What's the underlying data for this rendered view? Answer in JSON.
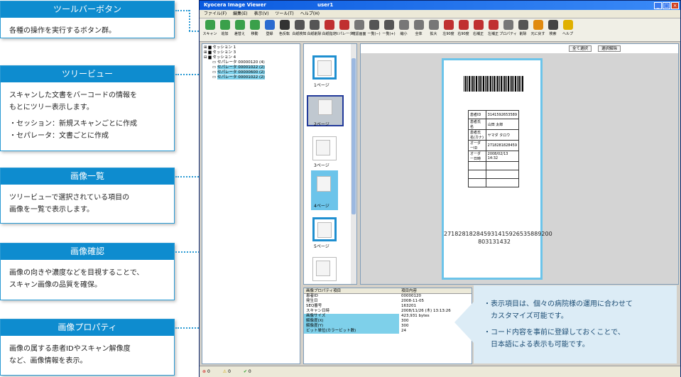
{
  "callouts": [
    {
      "title": "ツールバーボタン",
      "lines": [
        "各種の操作を実行するボタン群。"
      ]
    },
    {
      "title": "ツリービュー",
      "lines": [
        "スキャンした文書をバーコードの情報を",
        "もとにツリー表示します。",
        "・セッション：新規スキャンごとに作成",
        "・セパレータ：文書ごとに作成"
      ]
    },
    {
      "title": "画像一覧",
      "lines": [
        "ツリービューで選択されている項目の",
        "画像を一覧で表示します。"
      ]
    },
    {
      "title": "画像確認",
      "lines": [
        "画像の向きや濃度などを目視することで、",
        "スキャン画像の品質を確保。"
      ]
    },
    {
      "title": "画像プロパティ",
      "lines": [
        "画像の属する患者IDやスキャン解像度",
        "など、画像情報を表示。"
      ]
    }
  ],
  "app": {
    "title": "Kyocera Image Viewer",
    "user": "user1",
    "menu": [
      "ファイル(F)",
      "編集(E)",
      "表示(V)",
      "ツール(T)",
      "ヘルプ(H)"
    ],
    "toolbar": [
      "スキャン",
      "追加",
      "差替え",
      "移動",
      "登録",
      "色反転",
      "白紙検知",
      "白紙削除",
      "白紙指定",
      "セパレータ",
      "確認画面",
      "一覧(−)",
      "一覧(+)",
      "縮小",
      "全体",
      "拡大",
      "左90度",
      "右90度",
      "右補正",
      "左補正",
      "プロパティ",
      "削除",
      "元に戻す",
      "検索",
      "ヘルプ"
    ],
    "toolbar_colors": [
      "#3aa04a",
      "#3aa04a",
      "#3aa04a",
      "#3aa04a",
      "#2b6bd0",
      "#333",
      "#555",
      "#555",
      "#c03030",
      "#c03030",
      "#777",
      "#555",
      "#555",
      "#777",
      "#777",
      "#777",
      "#c03030",
      "#c03030",
      "#c03030",
      "#c03030",
      "#777",
      "#555",
      "#e08a10",
      "#444",
      "#e0b000"
    ],
    "tree": [
      "セッション 1",
      "セッション 3",
      "セッション 4",
      "セパレータ 00000120 (4)",
      "セパレータ 00001022 (2)",
      "セパレータ 00000600 (2)",
      "セパレータ 00001022 (2)"
    ],
    "thumbs": [
      "1ページ",
      "2ページ",
      "3ページ",
      "4ページ",
      "5ページ"
    ],
    "viewer_buttons": [
      "全て選択",
      "選択解除"
    ],
    "document": {
      "rows": [
        [
          "患者ID",
          "3141592653589"
        ],
        [
          "患者氏名",
          "山田 太郎"
        ],
        [
          "患者氏名(カナ)",
          "ヤマダ タロウ"
        ],
        [
          "オーダーID",
          "2718281828459"
        ],
        [
          "オーダー日時",
          "2008/02/13 14:32"
        ],
        [
          "",
          ""
        ],
        [
          "",
          ""
        ],
        [
          "",
          ""
        ]
      ],
      "barcode_line1": "271828182845931415926535889200",
      "barcode_line2": "803131432"
    },
    "props": {
      "header": [
        "画像プロパティ項目",
        "項目内容"
      ],
      "rows": [
        [
          "患者ID",
          "00000120"
        ],
        [
          "発生日",
          "2008-11-05"
        ],
        [
          "SEQ番号",
          "163201"
        ],
        [
          "スキャン日時",
          "2008/11/26 (木) 13:13:26"
        ],
        [
          "画像サイズ",
          "423,931 bytes"
        ],
        [
          "解像度(X)",
          "300"
        ],
        [
          "解像度(Y)",
          "300"
        ],
        [
          "ビット単位(カラービット数)",
          "24"
        ]
      ]
    },
    "status": [
      "0",
      "0",
      "0"
    ]
  },
  "note": [
    "・表示項目は、個々の病院様の運用に合わせて",
    "　カスタマイズ可能です。",
    "・コード内容を事前に登録しておくことで、",
    "　日本語による表示も可能です。"
  ]
}
